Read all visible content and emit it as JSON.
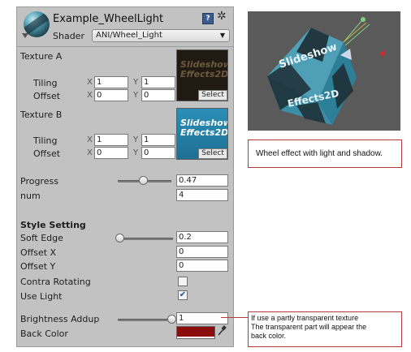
{
  "material": {
    "name": "Example_WheelLight",
    "shader_label": "Shader",
    "shader_value": "ANI/Wheel_Light"
  },
  "texture_a": {
    "label": "Texture A",
    "tiling_label": "Tiling",
    "offset_label": "Offset",
    "x_axis": "X",
    "y_axis": "Y",
    "tiling_x": "1",
    "tiling_y": "1",
    "offset_x": "0",
    "offset_y": "0",
    "thumb_text": "Slideshow Effects2D",
    "select_label": "Select"
  },
  "texture_b": {
    "label": "Texture B",
    "tiling_label": "Tiling",
    "offset_label": "Offset",
    "x_axis": "X",
    "y_axis": "Y",
    "tiling_x": "1",
    "tiling_y": "1",
    "offset_x": "0",
    "offset_y": "0",
    "thumb_text": "Slideshow Effects2D",
    "select_label": "Select"
  },
  "progress": {
    "label": "Progress",
    "value": "0.47",
    "fraction": 0.47
  },
  "num": {
    "label": "num",
    "value": "4"
  },
  "style": {
    "header": "Style Setting",
    "soft_edge_label": "Soft Edge",
    "soft_edge_value": "0.2",
    "soft_edge_fraction": 0.0,
    "offset_x_label": "Offset X",
    "offset_x_value": "0",
    "offset_y_label": "Offset Y",
    "offset_y_value": "0",
    "contra_label": "Contra Rotating",
    "contra_checked": false,
    "use_light_label": "Use Light",
    "use_light_checked": true,
    "brightness_label": "Brightness Addup",
    "brightness_value": "1",
    "brightness_fraction": 1.0,
    "back_color_label": "Back Color",
    "back_color_hex": "#8c0d0d"
  },
  "notes": {
    "wheel": "Wheel effect with light and shadow.",
    "transparent_line1": "If use a partly transparent texture",
    "transparent_line2": "The transparent part will appear the",
    "transparent_line3": "back color."
  },
  "icons": {
    "help": "help-icon",
    "gear": "gear-icon",
    "eyedropper": "eyedropper-icon",
    "foldout": "foldout-arrow-icon"
  },
  "colors": {
    "inspector_bg": "#c2c2c2",
    "annotation_border": "#b23a3a",
    "back_color": "#8c0d0d",
    "scene_bg": "#5b5b5b"
  }
}
